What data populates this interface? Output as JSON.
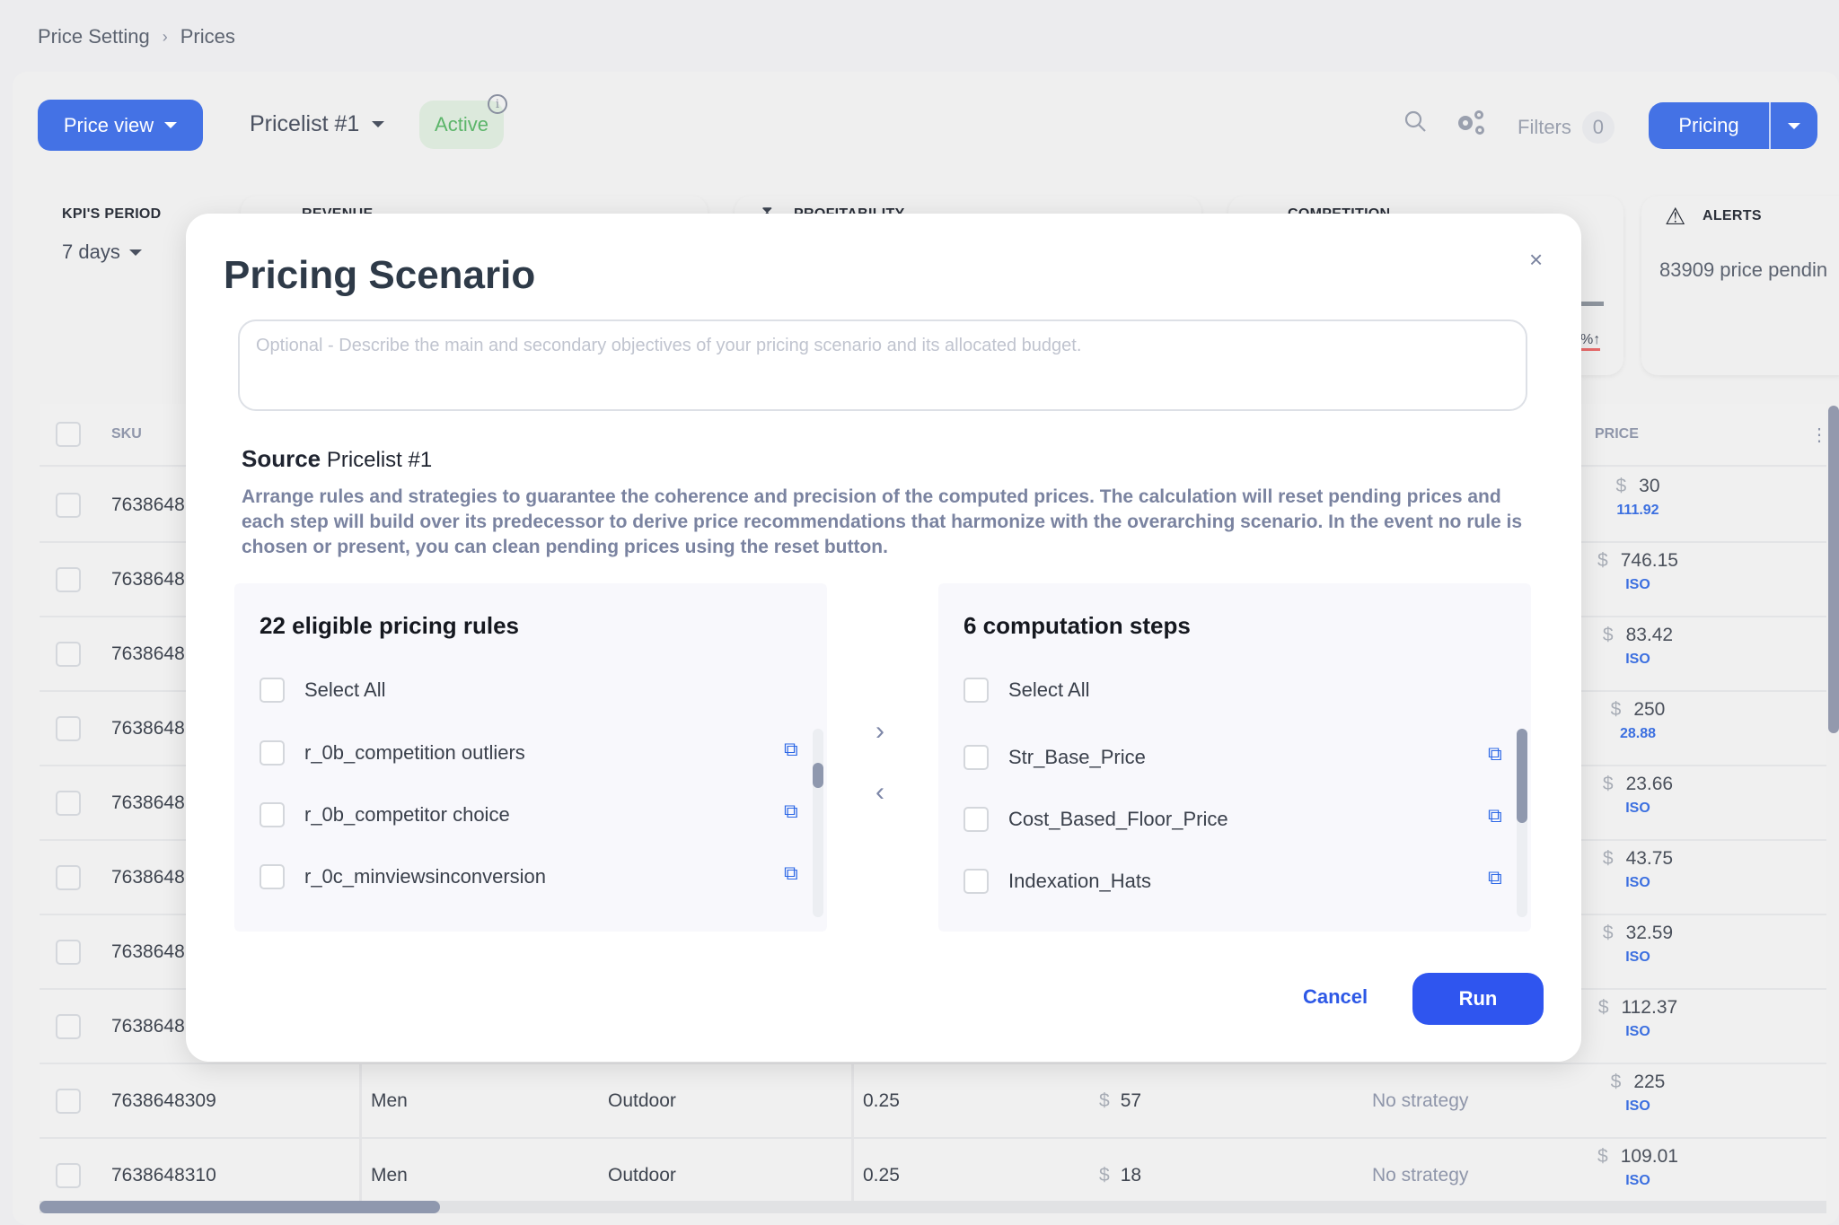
{
  "breadcrumb": {
    "items": [
      "Price Setting",
      "Prices"
    ],
    "separator": ">"
  },
  "toolbar": {
    "view_button": "Price view",
    "pricelist": "Pricelist #1",
    "status": "Active",
    "info_icon": "info-icon",
    "search_icon": "search-icon",
    "settings_icon": "gears-icon",
    "filters_label": "Filters",
    "filters_count": "0",
    "pricing_button": "Pricing"
  },
  "kpi": {
    "period_label": "KPI'S PERIOD",
    "period_value": "7 days",
    "cards": [
      {
        "title": "REVENUE",
        "icon": "revenue-icon"
      },
      {
        "title": "PROFITABILITY",
        "icon": "hourglass-icon",
        "alert": true
      },
      {
        "title": "COMPETITION",
        "icon": "competition-icon",
        "alert": true
      }
    ],
    "competition_delta": "%↑",
    "alerts_title": "ALERTS",
    "alerts_text": "83909 price pendin"
  },
  "table": {
    "columns": [
      "SKU",
      "PRICE"
    ],
    "rows": [
      {
        "sku": "7638648",
        "price": "30",
        "sub": "111.92"
      },
      {
        "sku": "7638648",
        "price": "746.15",
        "sub": "ISO"
      },
      {
        "sku": "7638648",
        "price": "83.42",
        "sub": "ISO"
      },
      {
        "sku": "7638648",
        "price": "250",
        "sub": "28.88"
      },
      {
        "sku": "7638648",
        "price": "23.66",
        "sub": "ISO"
      },
      {
        "sku": "7638648",
        "price": "43.75",
        "sub": "ISO"
      },
      {
        "sku": "7638648",
        "price": "32.59",
        "sub": "ISO"
      },
      {
        "sku": "7638648",
        "price": "112.37",
        "sub": "ISO"
      },
      {
        "sku": "7638648309",
        "gender": "Men",
        "category": "Outdoor",
        "elasticity": "0.25",
        "cost": "57",
        "strategy": "No strategy",
        "price": "225",
        "sub": "ISO"
      },
      {
        "sku": "7638648310",
        "gender": "Men",
        "category": "Outdoor",
        "elasticity": "0.25",
        "cost": "18",
        "strategy": "No strategy",
        "price": "109.01",
        "sub": "ISO"
      }
    ],
    "currency": "$"
  },
  "modal": {
    "title": "Pricing Scenario",
    "description_placeholder": "Optional - Describe the main and secondary objectives of your pricing scenario and its allocated budget.",
    "source_label": "Source",
    "source_value": "Pricelist #1",
    "help_text": "Arrange rules and strategies to guarantee the coherence and precision of the computed prices. The calculation will reset pending prices and each step will build over its predecessor to derive price recommendations that harmonize with the overarching scenario. In the event no rule is chosen or present, you can clean pending prices using the reset button.",
    "left_panel": {
      "title": "22 eligible pricing rules",
      "select_all": "Select All",
      "items": [
        "r_0b_competition outliers",
        "r_0b_competitor choice",
        "r_0c_minviewsinconversion"
      ]
    },
    "right_panel": {
      "title": "6 computation steps",
      "select_all": "Select All",
      "items": [
        "Str_Base_Price",
        "Cost_Based_Floor_Price",
        "Indexation_Hats"
      ]
    },
    "cancel": "Cancel",
    "run": "Run",
    "close": "×"
  }
}
